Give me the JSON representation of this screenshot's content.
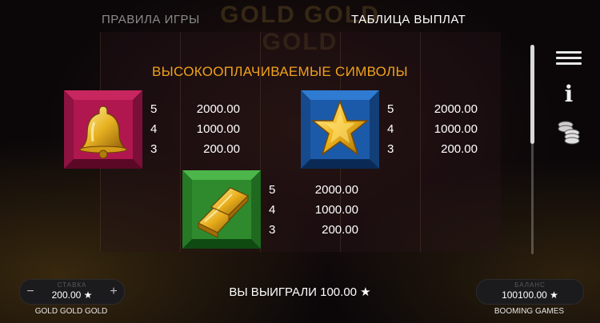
{
  "tabs": {
    "rules": "ПРАВИЛА ИГРЫ",
    "paytable": "ТАБЛИЦА ВЫПЛАТ"
  },
  "watermark": "GOLD GOLD GOLD",
  "section_title": "ВЫСОКООПЛАЧИВАЕМЫЕ СИМВОЛЫ",
  "symbols": [
    {
      "icon": "bell-icon",
      "tile_color": "#b0174f",
      "pays": [
        {
          "count": "5",
          "value": "2000.00"
        },
        {
          "count": "4",
          "value": "1000.00"
        },
        {
          "count": "3",
          "value": "200.00"
        }
      ]
    },
    {
      "icon": "star-icon",
      "tile_color": "#1b5aa8",
      "pays": [
        {
          "count": "5",
          "value": "2000.00"
        },
        {
          "count": "4",
          "value": "1000.00"
        },
        {
          "count": "3",
          "value": "200.00"
        }
      ]
    },
    {
      "icon": "gold-bars-icon",
      "tile_color": "#2e8a2c",
      "pays": [
        {
          "count": "5",
          "value": "2000.00"
        },
        {
          "count": "4",
          "value": "1000.00"
        },
        {
          "count": "3",
          "value": "200.00"
        }
      ]
    }
  ],
  "sidebar": {
    "icons": [
      "menu-icon",
      "info-icon",
      "coins-icon"
    ]
  },
  "bottom": {
    "bet_caption": "СТАВКА",
    "bet_value": "200.00 ★",
    "minus": "−",
    "plus": "+",
    "game_name": "GOLD GOLD GOLD",
    "win_message": "ВЫ ВЫИГРАЛИ 100.00 ★",
    "balance_caption": "БАЛАНС",
    "balance_value": "100100.00 ★",
    "provider": "BOOMING GAMES"
  },
  "scroll": {
    "position": 0.0
  },
  "colors": {
    "accent": "#f0a21c",
    "bell_tile": "#b0174f",
    "star_tile": "#1b5aa8",
    "bars_tile": "#2e8a2c"
  }
}
